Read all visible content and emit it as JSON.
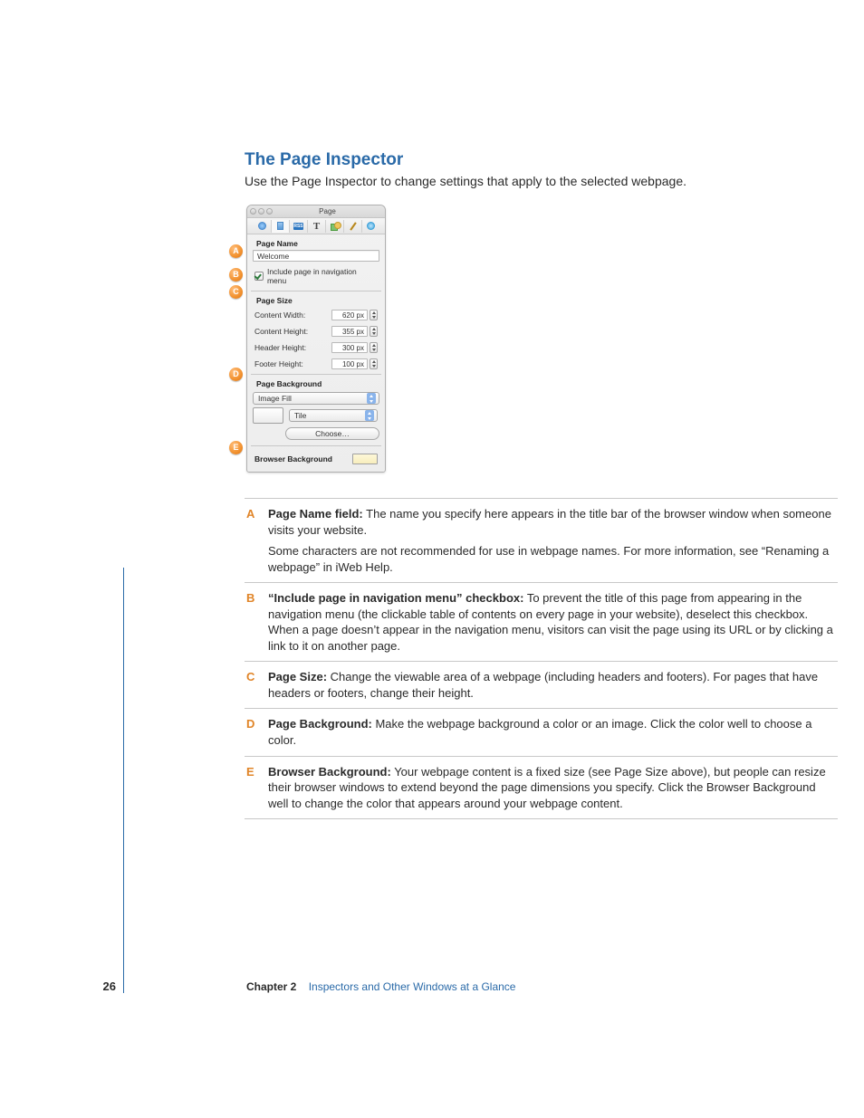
{
  "heading": "The Page Inspector",
  "intro": "Use the Page Inspector to change settings that apply to the selected webpage.",
  "inspector": {
    "title": "Page",
    "tabs_rss_label": "RSS",
    "tabs_t_glyph": "T",
    "sections": {
      "page_name_label": "Page Name",
      "page_name_value": "Welcome",
      "include_nav_label": "Include page in navigation menu",
      "page_size_label": "Page Size",
      "content_width_label": "Content Width:",
      "content_width_value": "620 px",
      "content_height_label": "Content Height:",
      "content_height_value": "355 px",
      "header_height_label": "Header Height:",
      "header_height_value": "300 px",
      "footer_height_label": "Footer Height:",
      "footer_height_value": "100 px",
      "page_background_label": "Page Background",
      "image_fill_label": "Image Fill",
      "tile_label": "Tile",
      "choose_label": "Choose…",
      "browser_background_label": "Browser Background"
    },
    "badges": {
      "a": "A",
      "b": "B",
      "c": "C",
      "d": "D",
      "e": "E"
    }
  },
  "definitions": [
    {
      "letter": "A",
      "title": "Page Name field:",
      "paragraphs": [
        "The name you specify here appears in the title bar of the browser window when someone visits your website.",
        "Some characters are not recommended for use in webpage names. For more information, see “Renaming a webpage” in iWeb Help."
      ]
    },
    {
      "letter": "B",
      "title": "“Include page in navigation menu” checkbox:",
      "paragraphs": [
        "To prevent the title of this page from appearing in the navigation menu (the clickable table of contents on every page in your website), deselect this checkbox. When a page doesn’t appear in the navigation menu, visitors can visit the page using its URL or by clicking a link to it on another page."
      ]
    },
    {
      "letter": "C",
      "title": "Page Size:",
      "paragraphs": [
        "Change the viewable area of a webpage (including headers and footers). For pages that have headers or footers, change their height."
      ]
    },
    {
      "letter": "D",
      "title": "Page Background:",
      "paragraphs": [
        "Make the webpage background a color or an image. Click the color well to choose a color."
      ]
    },
    {
      "letter": "E",
      "title": "Browser Background:",
      "paragraphs": [
        "Your webpage content is a fixed size (see Page Size above), but people can resize their browser windows to extend beyond the page dimensions you specify. Click the Browser Background well to change the color that appears around your webpage content."
      ]
    }
  ],
  "footer": {
    "page_number": "26",
    "chapter_label": "Chapter 2",
    "chapter_title": "Inspectors and Other Windows at a Glance"
  }
}
